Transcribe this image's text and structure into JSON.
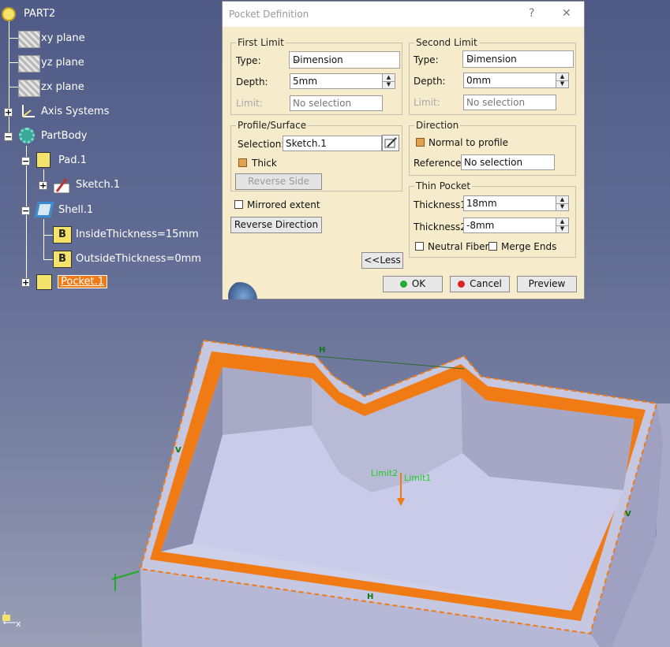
{
  "tree": {
    "root": "PART2",
    "items": [
      {
        "label": "xy plane"
      },
      {
        "label": "yz plane"
      },
      {
        "label": "zx plane"
      },
      {
        "label": "Axis Systems"
      },
      {
        "label": "PartBody"
      },
      {
        "label": "Pad.1"
      },
      {
        "label": "Sketch.1"
      },
      {
        "label": "Shell.1"
      },
      {
        "label": "InsideThickness=15mm",
        "icon_letter": "B"
      },
      {
        "label": "OutsideThickness=0mm",
        "icon_letter": "B"
      },
      {
        "label": "Pocket.1"
      }
    ]
  },
  "dialog": {
    "title": "Pocket Definition",
    "help": "?",
    "close": "✕",
    "first_limit": {
      "title": "First Limit",
      "type_label": "Type:",
      "type_value": "Dimension",
      "depth_label": "Depth:",
      "depth_value": "5mm",
      "limit_label": "Limit:",
      "limit_value": "No selection"
    },
    "second_limit": {
      "title": "Second Limit",
      "type_label": "Type:",
      "type_value": "Dimension",
      "depth_label": "Depth:",
      "depth_value": "0mm",
      "limit_label": "Limit:",
      "limit_value": "No selection"
    },
    "profile": {
      "title": "Profile/Surface",
      "selection_label": "Selection:",
      "selection_value": "Sketch.1",
      "thick_label": "Thick",
      "reverse_side": "Reverse Side"
    },
    "mirrored_extent": "Mirrored extent",
    "reverse_direction": "Reverse Direction",
    "direction": {
      "title": "Direction",
      "normal_label": "Normal to profile",
      "reference_label": "Reference:",
      "reference_value": "No selection"
    },
    "thin_pocket": {
      "title": "Thin Pocket",
      "thickness1_label": "Thickness1",
      "thickness1_value": "18mm",
      "thickness2_label": "Thickness2:",
      "thickness2_value": "-8mm",
      "neutral_fiber": "Neutral Fiber",
      "merge_ends": "Merge Ends"
    },
    "less_button": "<<Less",
    "ok_button": "OK",
    "cancel_button": "Cancel",
    "preview_button": "Preview"
  },
  "viewport": {
    "labels": {
      "limit2": "Limit2",
      "limit1": "Limit1",
      "h": "H",
      "v": "V",
      "axis_x": "x"
    }
  },
  "colors": {
    "selection_orange": "#f07a14",
    "ok_green": "#22aa33",
    "cancel_red": "#dd2222",
    "dialog_bg": "#f6eccb"
  }
}
